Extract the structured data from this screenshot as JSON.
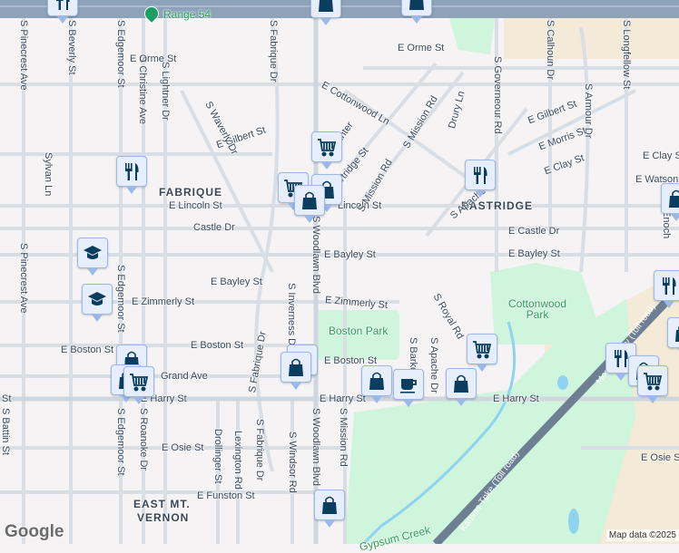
{
  "colors": {
    "background": "#f5f3f3",
    "park": "#cff5dd",
    "road": "#d9dee4",
    "highway": "#8ea3ba",
    "tollroad": "#6d7f93",
    "marker_icon": "#0b3d5e",
    "poi_pin": "#1e9e63",
    "water": "#8fd3f0"
  },
  "poi": {
    "name": "Range 54"
  },
  "districts": [
    "FABRIQUE",
    "EASTRIDGE",
    "EAST MT.",
    "VERNON"
  ],
  "parks": [
    "Boston Park",
    "Cottonwood Park"
  ],
  "water": [
    "Gypsum Creek"
  ],
  "tollroads": [
    "Kansas Tpke (Toll road)",
    "Monarch Pky (Toll road)"
  ],
  "streets": [
    "S Pinecrest Ave",
    "S Beverly St",
    "S Edgemoor St",
    "S Christine Ave",
    "S Lightner Dr",
    "S Fabrique Dr",
    "S Governeour Rd",
    "S Calhoun Dr",
    "S Longfellow St",
    "S Armour Dr",
    "Sylvan Ln",
    "S Woodlawn Blvd",
    "S Inverness Dr",
    "S Roanoke Dr",
    "S Battin St",
    "Drollinger St",
    "Lexington Rd",
    "S Windsor Rd",
    "S Mission Rd",
    "S Barker",
    "S Apache Dr",
    "S Royal Rd",
    "Enoch",
    "E Orme St",
    "E Cottonwood Ln",
    "E Gilbert St",
    "E Lincoln St",
    "Lincoln St",
    "Castle Dr",
    "E Castle Dr",
    "E Bayley St",
    "E Zimmerly St",
    "E Boston St",
    "Grand Ave",
    "E Harry St",
    "St",
    "E Osie St",
    "E Funston St",
    "E Morris St",
    "E Clay St",
    "E Watson St",
    "S Hunter",
    "Partridge St",
    "S Waverly Dr",
    "Drury Ln"
  ],
  "markers": [
    "fork-knife",
    "shopping-bag",
    "shopping-cart",
    "graduation-cap",
    "coffee-cup"
  ],
  "footer": {
    "logo": "Google",
    "attribution": "Map data ©2025"
  }
}
